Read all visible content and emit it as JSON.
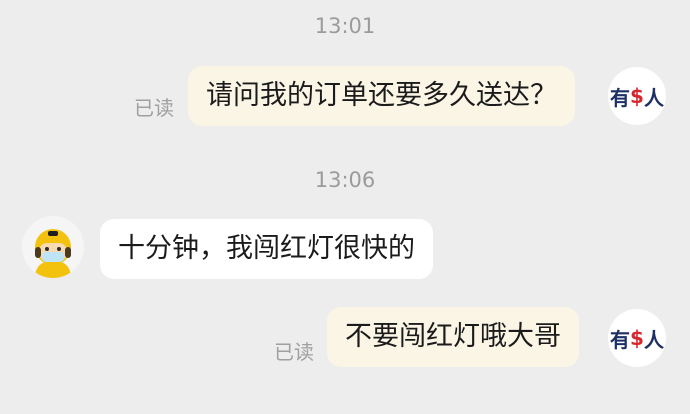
{
  "messages": [
    {
      "time": "13:01"
    },
    {
      "text": "请问我的订单还要多久送达？",
      "status": "已读"
    },
    {
      "time": "13:06"
    },
    {
      "text": "十分钟，我闯红灯很快的"
    },
    {
      "text": "不要闯红灯哦大哥",
      "status": "已读"
    }
  ],
  "user_avatar": {
    "part1": "有",
    "symbol": "$",
    "part2": "人"
  },
  "colors": {
    "background": "#ededed",
    "outgoing_bubble": "#fbf5e6",
    "incoming_bubble": "#ffffff",
    "avatar_text": "#1d2f64",
    "avatar_symbol": "#d7262e",
    "rider_helmet": "#f3c20f"
  },
  "icons": {
    "rider_avatar": "delivery-rider-icon"
  }
}
